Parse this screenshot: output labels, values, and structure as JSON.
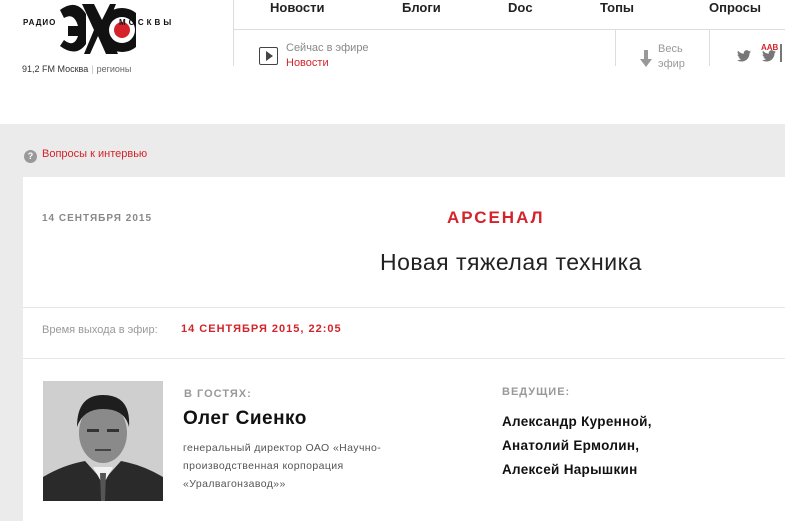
{
  "logo": {
    "radio": "РАДИО",
    "moskvy": "МОСКВЫ"
  },
  "frequency": {
    "station": "91,2 FM Москва",
    "separator": "|",
    "regions": "регионы"
  },
  "nav": {
    "items": [
      {
        "label": "Новости"
      },
      {
        "label": "Блоги"
      },
      {
        "label": "Doc"
      },
      {
        "label": "Топы"
      },
      {
        "label": "Опросы"
      }
    ]
  },
  "on_air": {
    "label": "Сейчас в эфире",
    "value": "Новости"
  },
  "archive": {
    "label": "Весь эфир"
  },
  "font_toggle": {
    "label": "AAB"
  },
  "questions_link": {
    "icon": "?",
    "label": "Вопросы к интервью"
  },
  "broadcast": {
    "date": "14 СЕНТЯБРЯ 2015",
    "program": "АРСЕНАЛ",
    "episode_title": "Новая тяжелая техника",
    "air_time_label": "Время выхода в эфир:",
    "air_time_value": "14 СЕНТЯБРЯ 2015, 22:05"
  },
  "guest": {
    "label": "В ГОСТЯХ:",
    "name": "Олег Сиенко",
    "description": "генеральный директор ОАО «Научно-производственная корпорация «Уралвагонзавод»»"
  },
  "hosts": {
    "label": "ВЕДУЩИЕ:",
    "names": [
      "Александр Куренной,",
      "Анатолий Ермолин,",
      "Алексей Нарышкин"
    ]
  },
  "colors": {
    "accent": "#d4232a",
    "page_bg": "#ebebeb",
    "text": "#222222"
  }
}
